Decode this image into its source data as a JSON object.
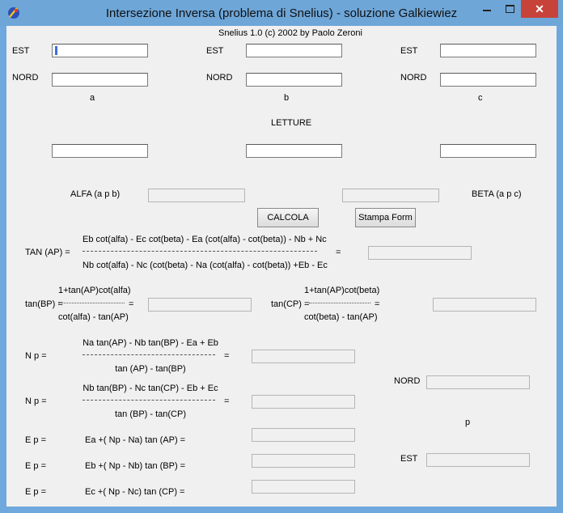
{
  "window": {
    "title": "Intersezione Inversa (problema di Snelius) - soluzione Galkiewiez",
    "close_glyph": "✕"
  },
  "header": {
    "credit": "Snelius 1.0 (c) 2002 by Paolo Zeroni"
  },
  "points": {
    "est_label": "EST",
    "nord_label": "NORD",
    "a": {
      "name": "a",
      "est": "",
      "nord": ""
    },
    "b": {
      "name": "b",
      "est": "",
      "nord": ""
    },
    "c": {
      "name": "c",
      "est": "",
      "nord": ""
    }
  },
  "letture": {
    "label": "LETTURE",
    "values": [
      "",
      "",
      ""
    ]
  },
  "angles": {
    "alfa_label": "ALFA (a p b)",
    "beta_label": "BETA (a p c)",
    "alfa_value": "",
    "beta_value": ""
  },
  "buttons": {
    "calcola": "CALCOLA",
    "stampa": "Stampa Form"
  },
  "formulas": {
    "tan_ap": {
      "label": "TAN (AP) =",
      "num": "Eb cot(alfa) - Ec cot(beta) - Ea (cot(alfa) - cot(beta)) - Nb + Nc",
      "den": "Nb cot(alfa) - Nc (cot(beta) - Na (cot(alfa) - cot(beta)) +Eb - Ec",
      "eq": "="
    },
    "tan_bp": {
      "label": "tan(BP) =",
      "num": "1+tan(AP)cot(alfa)",
      "den": "cot(alfa) - tan(AP)",
      "eq": "="
    },
    "tan_cp": {
      "label": "tan(CP) =",
      "num": "1+tan(AP)cot(beta)",
      "den": "cot(beta) - tan(AP)",
      "eq": "="
    },
    "np1": {
      "label": "N p =",
      "num": "Na tan(AP) - Nb tan(BP) - Ea + Eb",
      "den": "tan (AP) - tan(BP)",
      "eq": "="
    },
    "np2": {
      "label": "N p =",
      "num": "Nb tan(BP) - Nc tan(CP) - Eb + Ec",
      "den": "tan (BP) - tan(CP)",
      "eq": "="
    },
    "ep1": {
      "label": "E p =",
      "expr": "Ea +( Np - Na) tan (AP) ="
    },
    "ep2": {
      "label": "E p =",
      "expr": "Eb +( Np - Nb) tan (BP) ="
    },
    "ep3": {
      "label": "E p =",
      "expr": "Ec +( Np - Nc) tan (CP) ="
    }
  },
  "result": {
    "nord_label": "NORD",
    "est_label": "EST",
    "point_label": "p"
  }
}
